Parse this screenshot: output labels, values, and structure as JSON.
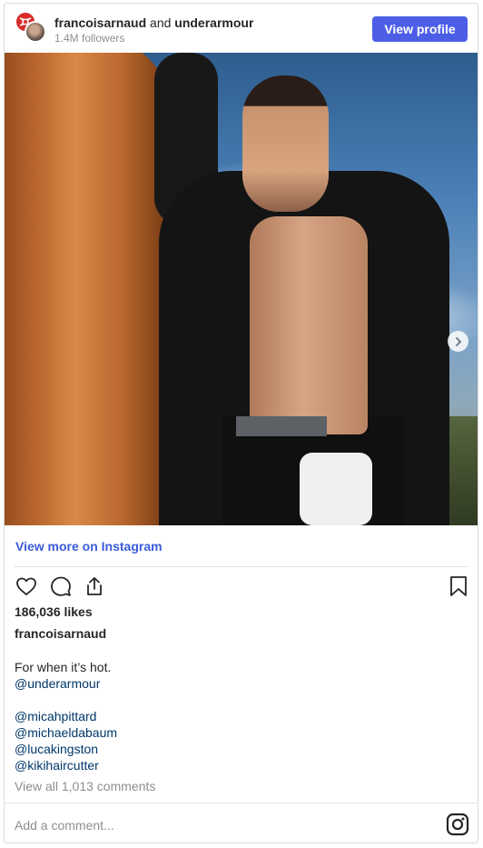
{
  "header": {
    "user1": "francoisarnaud",
    "connector": "and",
    "user2": "underarmour",
    "followers": "1.4M followers",
    "view_profile_label": "View profile"
  },
  "post": {
    "view_more_label": "View more on Instagram",
    "likes": "186,036 likes",
    "owner": "francoisarnaud",
    "caption_line1": "For when it’s hot.",
    "caption_mention": "@underarmour",
    "tagged": [
      "@micahpittard",
      "@michaeldabaum",
      "@lucakingston",
      "@kikihaircutter"
    ],
    "comments_link": "View all 1,013 comments",
    "add_comment_placeholder": "Add a comment..."
  },
  "carousel": {
    "count": 2,
    "active_index": 0
  },
  "icons": [
    "heart-icon",
    "comment-icon",
    "share-icon",
    "bookmark-icon",
    "chevron-right-icon",
    "instagram-icon"
  ],
  "colors": {
    "accent": "#4c5ee6",
    "link": "#3b5bdb",
    "mention": "#00376b",
    "muted": "#8e8e8e"
  }
}
